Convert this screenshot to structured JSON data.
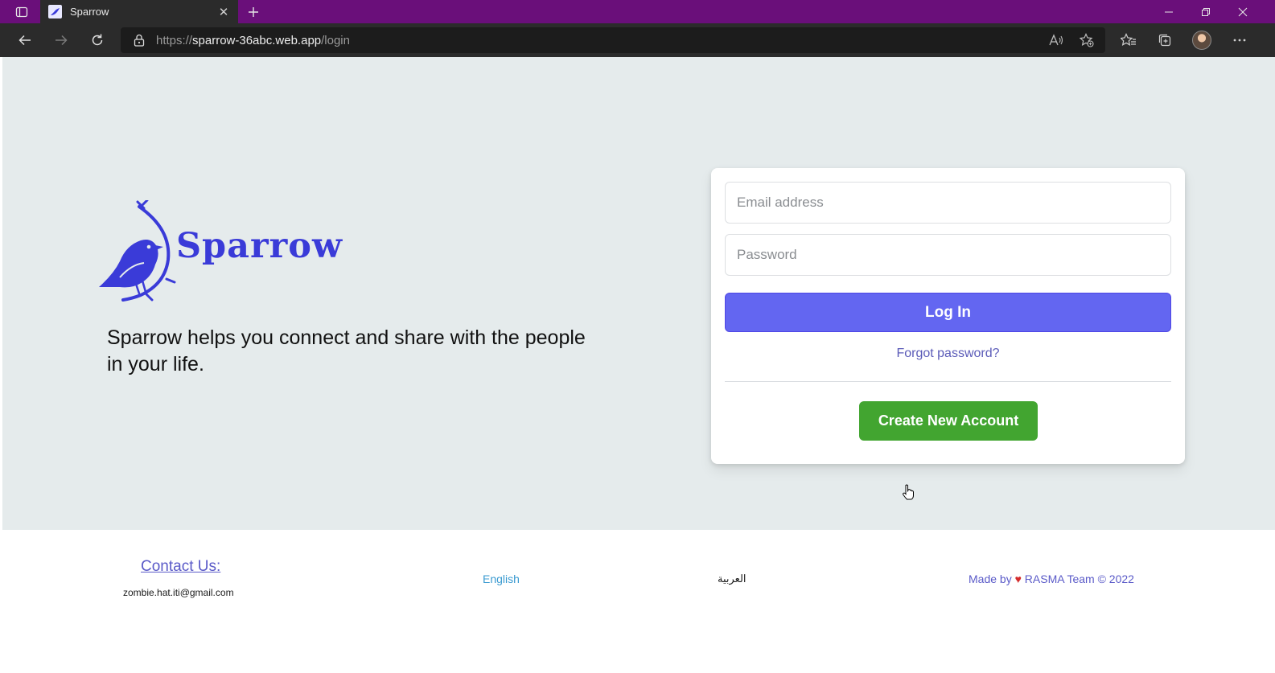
{
  "browser": {
    "tab_title": "Sparrow",
    "url_scheme": "https://",
    "url_host": "sparrow-36abc.web.app",
    "url_path": "/login"
  },
  "brand": {
    "name": "Sparrow",
    "tagline": "Sparrow helps you connect and share with the people in your life.",
    "color": "#3a3bd8"
  },
  "login": {
    "email_placeholder": "Email address",
    "password_placeholder": "Password",
    "login_label": "Log In",
    "forgot_label": "Forgot password?",
    "create_label": "Create New Account",
    "login_color": "#6366f1",
    "create_color": "#42a530"
  },
  "footer": {
    "contact_title": "Contact Us:",
    "contact_email": "zombie.hat.iti@gmail.com",
    "lang_english": "English",
    "lang_arabic": "العربية",
    "made_by_prefix": "Made by",
    "heart": "♥",
    "made_by_suffix": "RASMA Team © 2022"
  }
}
